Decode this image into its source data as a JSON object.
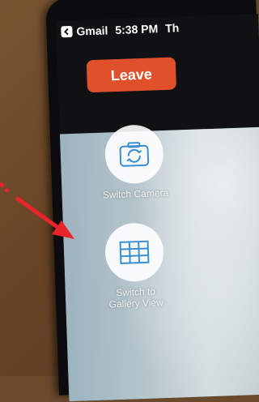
{
  "status_bar": {
    "back_app": "Gmail",
    "time": "5:38 PM",
    "day": "Th"
  },
  "actions": {
    "leave_label": "Leave"
  },
  "controls": {
    "switch_camera_label": "Switch Camera",
    "gallery_view_label_line1": "Switch to",
    "gallery_view_label_line2": "Gallery View"
  },
  "icons": {
    "back": "chevron-left-icon",
    "switch_camera": "camera-rotate-icon",
    "gallery_view": "grid-icon",
    "annotation": "red-arrow"
  },
  "colors": {
    "leave_button": "#e0502b",
    "icon_blue": "#3a8fd3",
    "annotation_arrow": "#e8252a"
  }
}
